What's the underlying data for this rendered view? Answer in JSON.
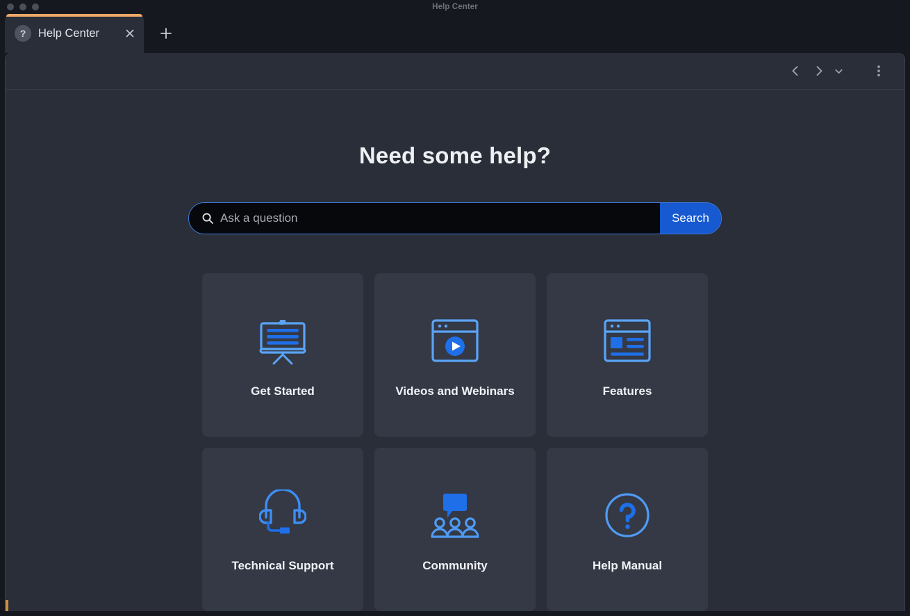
{
  "window": {
    "os_title": "Help Center",
    "traffic_lights": [
      "close-dot",
      "minimize-dot",
      "maximize-dot"
    ],
    "accent_color": "#f0a868"
  },
  "tabs": {
    "active": {
      "title": "Help Center",
      "favicon": "question-mark-favicon",
      "close_glyph": "✕"
    },
    "new_tab_glyph": "+"
  },
  "toolbar": {
    "back": "back-arrow",
    "forward": "forward-arrow",
    "dropdown": "chevron-down",
    "menu": "three-dot-menu"
  },
  "page": {
    "title": "Need some help?",
    "accent_blue": "#1759d0",
    "icon_blue": "#3d8ef5",
    "card_bg": "#343945"
  },
  "search": {
    "placeholder": "Ask a question",
    "value": "",
    "button_label": "Search",
    "icon": "magnifier-icon"
  },
  "cards": [
    {
      "label": "Get Started",
      "icon": "presentation-board-icon"
    },
    {
      "label": "Videos and Webinars",
      "icon": "video-player-window-icon"
    },
    {
      "label": "Features",
      "icon": "layout-window-icon"
    },
    {
      "label": "Technical Support",
      "icon": "headset-icon"
    },
    {
      "label": "Community",
      "icon": "people-chat-icon"
    },
    {
      "label": "Help Manual",
      "icon": "question-circle-icon"
    }
  ]
}
